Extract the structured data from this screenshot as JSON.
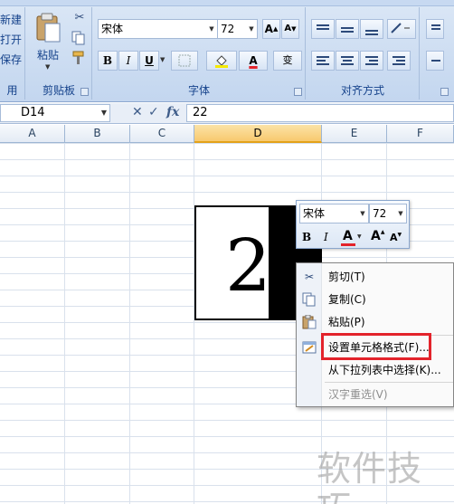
{
  "ribbon": {
    "clipboard_partial": [
      "新建",
      "打开",
      "保存"
    ],
    "clipboard_partial_group": "用",
    "paste_label": "粘贴",
    "clipboard_group_label": "剪贴板",
    "font_name": "宋体",
    "font_size": "72",
    "bold": "B",
    "italic": "I",
    "underline": "U",
    "font_color_glyph": "A",
    "grow_font": "A",
    "shrink_font": "A",
    "phonetic_glyph": "变",
    "font_group_label": "字体",
    "alignment_group_label": "对齐方式"
  },
  "formula_bar": {
    "name_box": "D14",
    "fx_label": "fx",
    "value": "22"
  },
  "columns": [
    "A",
    "B",
    "C",
    "D",
    "E",
    "F"
  ],
  "selected_column": "D",
  "cell_display": "22",
  "mini_toolbar": {
    "font_name": "宋体",
    "font_size": "72",
    "bold": "B",
    "italic": "I",
    "font_color_glyph": "A",
    "grow_font": "A",
    "shrink_font": "A"
  },
  "context_menu": {
    "items": [
      {
        "label": "剪切(T)",
        "icon": "scissors-icon",
        "enabled": true
      },
      {
        "label": "复制(C)",
        "icon": "copy-icon",
        "enabled": true
      },
      {
        "label": "粘贴(P)",
        "icon": "paste-icon",
        "enabled": true
      },
      {
        "label": "设置单元格格式(F)...",
        "icon": "format-cells-icon",
        "enabled": true,
        "highlighted": true
      },
      {
        "label": "从下拉列表中选择(K)...",
        "icon": "",
        "enabled": true
      },
      {
        "label": "汉字重选(V)",
        "icon": "",
        "enabled": false
      }
    ]
  },
  "watermark": "软件技巧",
  "colors": {
    "highlight_box": "#e3232b",
    "selected_header": "#f8c96e",
    "ribbon_text": "#15428b",
    "font_color_bar": "#e3232b"
  }
}
